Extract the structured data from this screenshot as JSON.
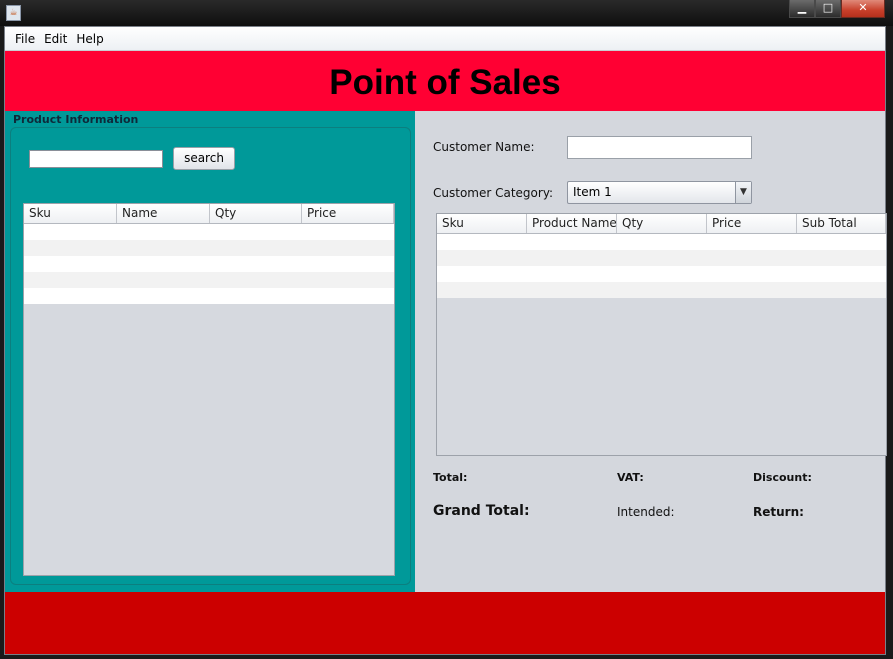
{
  "titlebar": {
    "icon": "java-cup-icon"
  },
  "menu": [
    "File",
    "Edit",
    "Help"
  ],
  "header": {
    "title": "Point of Sales"
  },
  "product_info": {
    "title": "Product Information",
    "search_value": "",
    "search_button": "search",
    "columns": [
      "Sku",
      "Name",
      "Qty",
      "Price"
    ]
  },
  "customer": {
    "name_label": "Customer Name:",
    "name_value": "",
    "category_label": "Customer Category:",
    "category_selected": "Item 1"
  },
  "cart": {
    "columns": [
      "Sku",
      "Product Name",
      "Qty",
      "Price",
      "Sub Total"
    ]
  },
  "totals": {
    "total_label": "Total:",
    "vat_label": "VAT:",
    "discount_label": "Discount:",
    "grand_total_label": "Grand Total:",
    "intended_label": "Intended:",
    "return_label": "Return:"
  },
  "colors": {
    "header": "#ff0033",
    "product_panel": "#009999",
    "footer": "#cc0000"
  }
}
